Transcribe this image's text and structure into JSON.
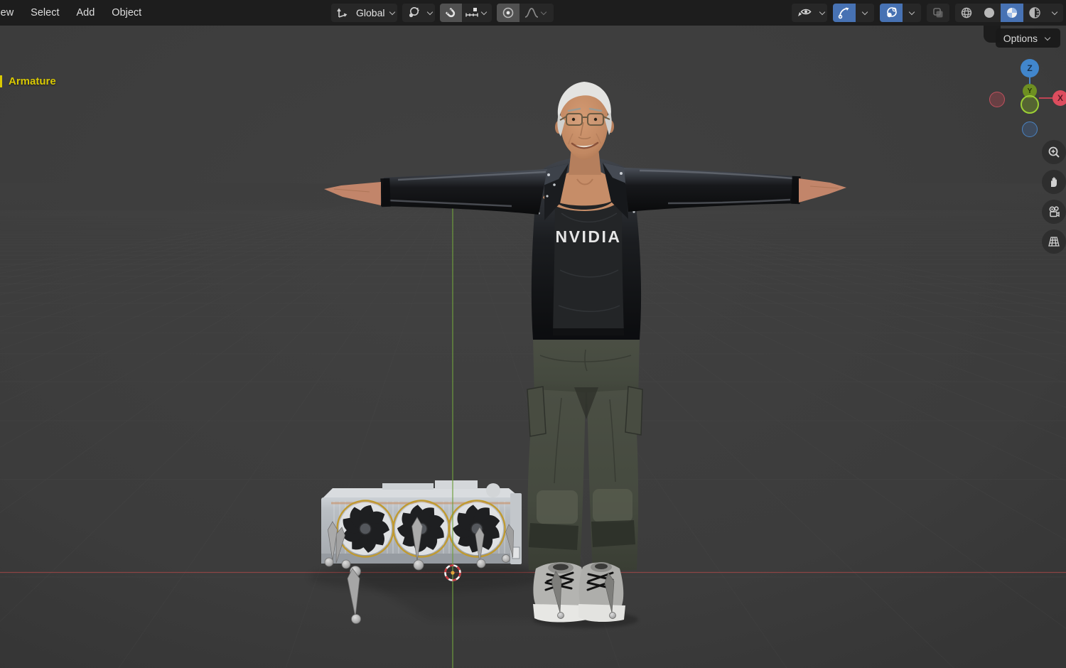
{
  "header": {
    "menus": [
      {
        "label": "View"
      },
      {
        "label": "Select"
      },
      {
        "label": "Add"
      },
      {
        "label": "Object"
      }
    ],
    "orientation_label": "Global",
    "controls": {
      "pivot": "pivot-point-dropdown",
      "snap": "snap-magnet-toggle",
      "snap_with": "snap-settings-dropdown",
      "proportional": "proportional-editing-toggle",
      "falloff": "proportional-falloff-dropdown"
    },
    "right_tools": [
      "show-object-types",
      "gizmos-toggle",
      "overlays-toggle",
      "xray-toggle",
      "shading-wireframe",
      "shading-solid",
      "shading-material-preview",
      "shading-rendered"
    ]
  },
  "viewport": {
    "options_label": "Options",
    "active_object_label": "Armature",
    "shirt_text": "NVIDIA",
    "axis_labels": {
      "z": "Z",
      "x": "X",
      "y": "Y"
    },
    "side_tools": [
      "zoom",
      "pan",
      "camera-view",
      "toggle-orthographic"
    ]
  },
  "colors": {
    "header_bg": "#1d1d1d",
    "accent_blue": "#4772b3",
    "active_object_yellow": "#d9c903",
    "viewport_bg": "#3d3d3d",
    "grid_line": "#4b4b4b",
    "axis_x_red": "#9a4747",
    "axis_y_green": "#6f9e3e",
    "gizmo_z_blue": "#4186cc",
    "gizmo_x_red": "#dd4d5e",
    "gizmo_y_green": "#6e8f22",
    "gpu_fan_ring_gold": "#c09a30"
  }
}
